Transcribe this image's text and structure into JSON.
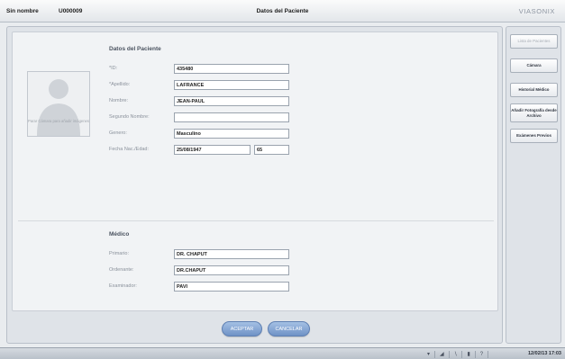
{
  "header": {
    "patient_name": "Sin nombre",
    "patient_id": "U000009",
    "title": "Datos del Paciente",
    "brand": "VIASONIX"
  },
  "photo": {
    "caption": "Parar Cámara para añadir imágenes"
  },
  "patient_section": {
    "title": "Datos del Paciente",
    "fields": [
      {
        "label": "*ID:",
        "value": "435480"
      },
      {
        "label": "*Apellido:",
        "value": "LAFRANCE"
      },
      {
        "label": "Nombre:",
        "value": "JEAN-PAUL"
      },
      {
        "label": "Segundo Nombre:",
        "value": ""
      },
      {
        "label": "Genero:",
        "value": "Masculino"
      },
      {
        "label": "Fecha Nac./Edad:",
        "value": "25/08/1947",
        "age": "65"
      }
    ]
  },
  "doctor_section": {
    "title": "Médico",
    "fields": [
      {
        "label": "Primario:",
        "value": "DR. CHAPUT"
      },
      {
        "label": "Ordenante:",
        "value": "DR.CHAPUT"
      },
      {
        "label": "Examinador:",
        "value": "PAVI"
      }
    ]
  },
  "actions": {
    "accept": "ACEPTAR",
    "cancel": "CANCELAR"
  },
  "sidebar": {
    "items": [
      {
        "label": "Lista de Pacientes",
        "enabled": false
      },
      {
        "label": "Cámara",
        "enabled": true
      },
      {
        "label": "Historial Médico",
        "enabled": true
      },
      {
        "label": "Añadir Fotografía desde Archivo",
        "enabled": true
      },
      {
        "label": "Exámenes Previos",
        "enabled": true
      }
    ]
  },
  "taskbar": {
    "clock": "12/02/13 17:03",
    "tray_icons": [
      "network-icon",
      "volume-icon",
      "bluetooth-icon",
      "power-icon",
      "help-icon"
    ]
  }
}
